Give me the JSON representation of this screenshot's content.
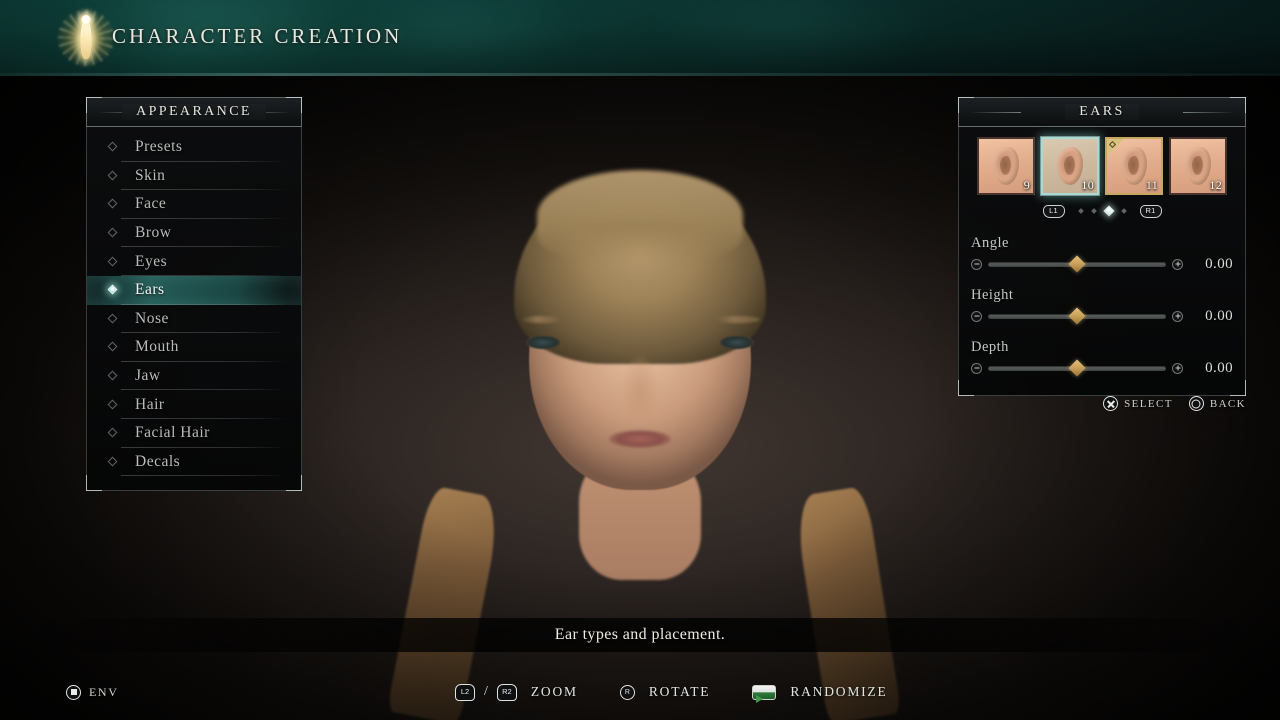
{
  "header": {
    "title": "CHARACTER CREATION",
    "logo_icon": "glowing-figure-icon"
  },
  "sidebar": {
    "title": "APPEARANCE",
    "items": [
      {
        "label": "Presets",
        "selected": false
      },
      {
        "label": "Skin",
        "selected": false
      },
      {
        "label": "Face",
        "selected": false
      },
      {
        "label": "Brow",
        "selected": false
      },
      {
        "label": "Eyes",
        "selected": false
      },
      {
        "label": "Ears",
        "selected": true
      },
      {
        "label": "Nose",
        "selected": false
      },
      {
        "label": "Mouth",
        "selected": false
      },
      {
        "label": "Jaw",
        "selected": false
      },
      {
        "label": "Hair",
        "selected": false
      },
      {
        "label": "Facial Hair",
        "selected": false
      },
      {
        "label": "Decals",
        "selected": false
      }
    ]
  },
  "options_panel": {
    "title": "EARS",
    "thumbnails": [
      {
        "number": "9",
        "selected": false,
        "equipped": false
      },
      {
        "number": "10",
        "selected": true,
        "equipped": false
      },
      {
        "number": "11",
        "selected": false,
        "equipped": true
      },
      {
        "number": "12",
        "selected": false,
        "equipped": false
      }
    ],
    "pager": {
      "prev_button": "L1",
      "next_button": "R1",
      "total_pages": 4,
      "active_page": 3
    },
    "sliders": [
      {
        "label": "Angle",
        "value": "0.00",
        "position_pct": 50
      },
      {
        "label": "Height",
        "value": "0.00",
        "position_pct": 50
      },
      {
        "label": "Depth",
        "value": "0.00",
        "position_pct": 50
      }
    ],
    "prompts": [
      {
        "glyph": "cross-button-icon",
        "label": "SELECT"
      },
      {
        "glyph": "circle-button-icon",
        "label": "BACK"
      }
    ]
  },
  "tooltip": {
    "text": "Ear types and placement."
  },
  "bottom_bar": {
    "env": {
      "glyph": "options-button-icon",
      "label": "ENV"
    },
    "actions": [
      {
        "glyph": "l2-r2-trigger-icon",
        "left": "L2",
        "right": "R2",
        "label": "ZOOM"
      },
      {
        "glyph": "r3-stick-icon",
        "label": "ROTATE"
      },
      {
        "glyph": "touchpad-icon",
        "label": "RANDOMIZE"
      }
    ]
  },
  "colors": {
    "accent_teal": "#6fd6c8",
    "accent_gold": "#c9a05a",
    "banner_green": "#0d3b37",
    "text_primary": "#e9e6de"
  }
}
